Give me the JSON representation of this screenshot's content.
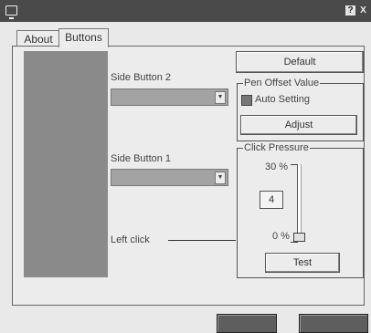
{
  "window": {
    "title_icon": "app-window-icon",
    "help_label": "?",
    "close_label": "X"
  },
  "tabs": [
    {
      "label": "About",
      "active": false
    },
    {
      "label": "Buttons",
      "active": true
    }
  ],
  "side_button_2": {
    "label": "Side Button 2",
    "value": ""
  },
  "side_button_1": {
    "label": "Side Button 1",
    "value": ""
  },
  "left_click": {
    "label": "Left click"
  },
  "default_button": {
    "label": "Default"
  },
  "pen_offset": {
    "legend": "Pen Offset Value",
    "auto_setting_label": "Auto Setting",
    "auto_setting_checked": true,
    "adjust_label": "Adjust"
  },
  "click_pressure": {
    "legend": "Click Pressure",
    "max_label": "30 %",
    "min_label": "0 %",
    "value": "4",
    "slider_fraction": 0.07,
    "test_label": "Test"
  },
  "colors": {
    "titlebar": "#4a4a4a",
    "dialog_bg": "#ececec",
    "preview_area": "#8a8a8a"
  }
}
